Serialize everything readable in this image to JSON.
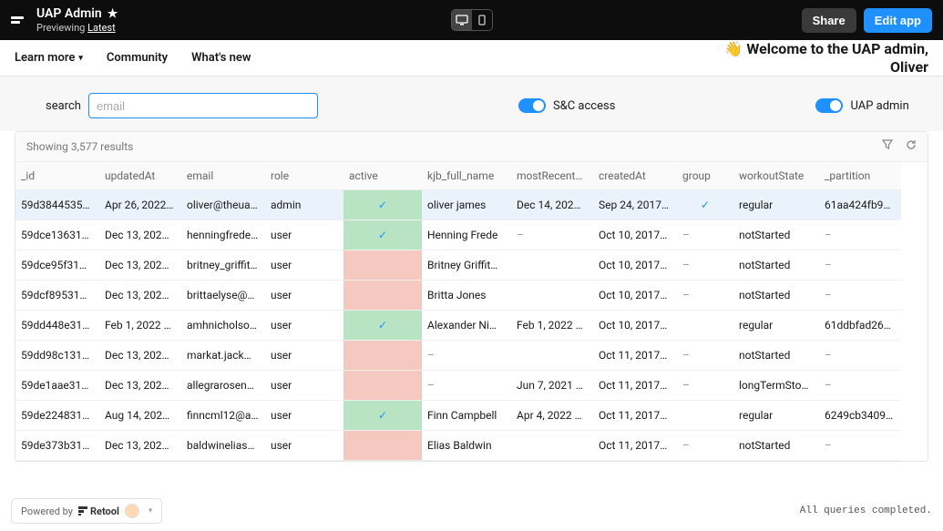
{
  "topbar": {
    "title": "UAP Admin",
    "previewing_label": "Previewing",
    "previewing_link": "Latest",
    "share_label": "Share",
    "edit_label": "Edit app"
  },
  "nav": {
    "learn_more": "Learn more",
    "community": "Community",
    "whats_new": "What's new",
    "welcome_line1": "👋 Welcome to the UAP admin,",
    "welcome_line2": "Oliver"
  },
  "filters": {
    "search_label": "search",
    "search_placeholder": "email",
    "search_value": "",
    "toggle1_label": "S&C access",
    "toggle2_label": "UAP admin"
  },
  "table": {
    "results_text": "Showing 3,577 results",
    "columns": [
      "_id",
      "updatedAt",
      "email",
      "role",
      "active",
      "kjb_full_name",
      "mostRecentW…",
      "createdAt",
      "group",
      "workoutState",
      "_partition"
    ],
    "rows": [
      {
        "selected": true,
        "_id": "59d3844535…",
        "updatedAt": "Apr 26, 2022…",
        "email": "oliver@theua…",
        "role": "admin",
        "active": true,
        "kjb_full_name": "oliver james",
        "mostRecent": "Dec 14, 202…",
        "createdAt": "Sep 24, 2017…",
        "group": "✓",
        "workoutState": "regular",
        "_partition": "61aa424fb9…"
      },
      {
        "_id": "59dce13631…",
        "updatedAt": "Dec 13, 202…",
        "email": "henningfrede…",
        "role": "user",
        "active": true,
        "kjb_full_name": "Henning Frede",
        "mostRecent": "–",
        "createdAt": "Oct 10, 2017…",
        "group": "–",
        "workoutState": "notStarted",
        "_partition": "–"
      },
      {
        "_id": "59dce95f31…",
        "updatedAt": "Dec 13, 202…",
        "email": "britney_griffit…",
        "role": "user",
        "active": false,
        "kjb_full_name": "Britney Griffit…",
        "mostRecent": "",
        "createdAt": "Oct 10, 2017…",
        "group": "–",
        "workoutState": "notStarted",
        "_partition": "–"
      },
      {
        "_id": "59dcf89531…",
        "updatedAt": "Dec 13, 202…",
        "email": "brittaelyse@g…",
        "role": "user",
        "active": false,
        "kjb_full_name": "Britta Jones",
        "mostRecent": "",
        "createdAt": "Oct 10, 2017…",
        "group": "–",
        "workoutState": "notStarted",
        "_partition": "–"
      },
      {
        "_id": "59dd448e31…",
        "updatedAt": "Feb 1, 2022 …",
        "email": "amhnicholson…",
        "role": "user",
        "active": true,
        "kjb_full_name": "Alexander Ni…",
        "mostRecent": "Feb 1, 2022 …",
        "createdAt": "Oct 10, 2017…",
        "group": "",
        "workoutState": "regular",
        "_partition": "61ddbfad26…"
      },
      {
        "_id": "59dd98c131…",
        "updatedAt": "Dec 13, 202…",
        "email": "markat.jack@…",
        "role": "user",
        "active": false,
        "kjb_full_name": "–",
        "mostRecent": "",
        "createdAt": "Oct 11, 2017…",
        "group": "–",
        "workoutState": "notStarted",
        "_partition": "–"
      },
      {
        "_id": "59de1aae31…",
        "updatedAt": "Dec 13, 202…",
        "email": "allegrarosenb…",
        "role": "user",
        "active": false,
        "kjb_full_name": "–",
        "mostRecent": "Jun 7, 2021 …",
        "createdAt": "Oct 11, 2017…",
        "group": "–",
        "workoutState": "longTermSto…",
        "_partition": "–"
      },
      {
        "_id": "59de224831…",
        "updatedAt": "Aug 14, 202…",
        "email": "finncml12@a…",
        "role": "user",
        "active": true,
        "kjb_full_name": "Finn Campbell",
        "mostRecent": "Apr 4, 2022 …",
        "createdAt": "Oct 11, 2017…",
        "group": "",
        "workoutState": "regular",
        "_partition": "6249cb3409…"
      },
      {
        "_id": "59de373b31…",
        "updatedAt": "Dec 13, 202…",
        "email": "baldwinelias7…",
        "role": "user",
        "active": false,
        "kjb_full_name": "Elias Baldwin",
        "mostRecent": "",
        "createdAt": "Oct 11, 2017…",
        "group": "–",
        "workoutState": "notStarted",
        "_partition": "–"
      }
    ]
  },
  "footer": {
    "powered_label": "Powered by",
    "brand": "Retool",
    "queries_text": "All queries completed."
  }
}
